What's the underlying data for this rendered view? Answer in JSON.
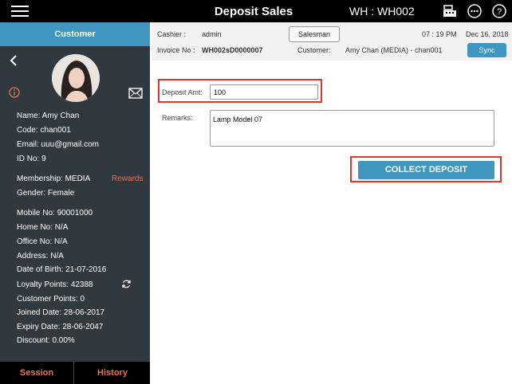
{
  "topbar": {
    "title": "Deposit Sales",
    "warehouse": "WH : WH002",
    "icons": [
      "menu-icon",
      "cash-register-icon",
      "more-icon",
      "help-icon"
    ]
  },
  "sidebar": {
    "header": "Customer",
    "customer": {
      "name": "Name: Amy Chan",
      "code": "Code: chan001",
      "email": "Email: uuu@gmail.com",
      "id_no": "ID No: 9",
      "membership": "Membership: MEDIA",
      "rewards": "Rewards",
      "gender": "Gender: Female",
      "mobile": "Mobile No: 90001000",
      "home": "Home No: N/A",
      "office": "Office No: N/A",
      "address": "Address: N/A",
      "dob": "Date of Birth: 21-07-2016",
      "loyalty": "Loyalty Points: 42388",
      "customer_points": "Customer Points: 0",
      "joined": "Joined Date: 28-06-2017",
      "expiry": "Expiry Date: 28-06-2047",
      "discount": "Discount: 0.00%"
    },
    "tabs": {
      "session": "Session",
      "history": "History"
    }
  },
  "infobar": {
    "cashier_label": "Cashier :",
    "cashier_value": "admin",
    "salesman_button": "Salesman",
    "time": "07 : 19 PM",
    "date": "Dec 16, 2018",
    "invoice_label": "Invoice No :",
    "invoice_value": "WH002sD0000007",
    "customer_label": "Customer:",
    "customer_value": "Amy Chan (MEDIA) - chan001",
    "sync_button": "Sync"
  },
  "form": {
    "deposit_label": "Deposit Amt:",
    "deposit_value": "100",
    "remarks_label": "Remarks:",
    "remarks_value": "Lamp Model 07",
    "collect_button": "COLLECT DEPOSIT"
  },
  "colors": {
    "accent": "#3f97c0",
    "sidebar_bg": "#303840",
    "highlight": "#e0362c",
    "link": "#e9724c"
  }
}
